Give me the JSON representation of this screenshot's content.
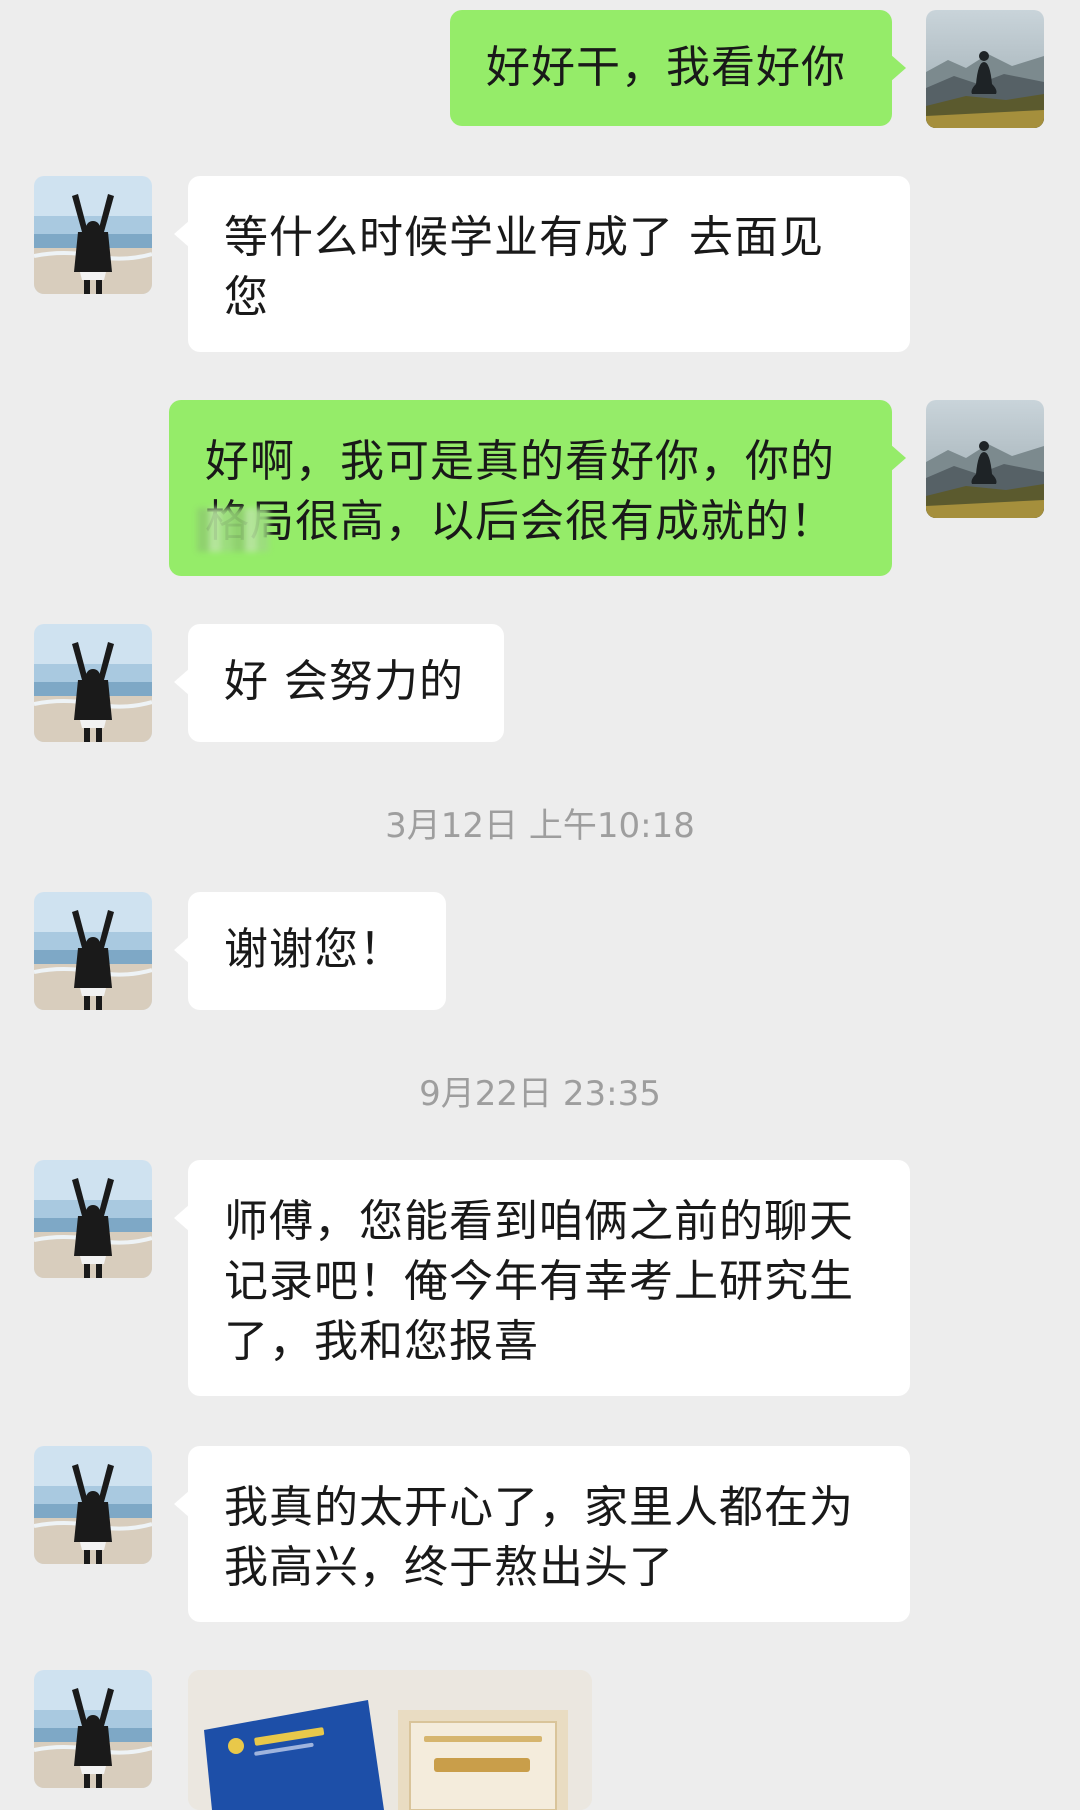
{
  "messages": [
    {
      "side": "sent",
      "text": "好好干，我看好你"
    },
    {
      "side": "recv",
      "text": "等什么时候学业有成了 去面见您"
    },
    {
      "side": "sent",
      "text": "好啊，我可是真的看好你，你的格局很高，以后会很有成就的！"
    },
    {
      "side": "recv",
      "text": "好 会努力的"
    },
    {
      "side": "recv",
      "text": "谢谢您！"
    },
    {
      "side": "recv",
      "text": "师傅，您能看到咱俩之前的聊天记录吧！俺今年有幸考上研究生了，我和您报喜"
    },
    {
      "side": "recv",
      "text": "我真的太开心了，家里人都在为我高兴，终于熬出头了"
    },
    {
      "side": "recv",
      "type": "image"
    }
  ],
  "timestamps": [
    "3月12日 上午10:18",
    "9月22日 23:35"
  ],
  "message_texts": {
    "m1": "好好干，我看好你",
    "m2_line1": "等什么时候学业有成了 去面见",
    "m2_line2": "您",
    "m3_line1": "好啊，我可是真的看好你，你的",
    "m3_line2": "格局很高，以后会很有成就的！",
    "m4": "好 会努力的",
    "m5": "谢谢您！",
    "m6_line1": "师傅，您能看到咱俩之前的聊天",
    "m6_line2": "记录吧！俺今年有幸考上研究生",
    "m6_line3": "了，我和您报喜",
    "m7_line1": "我真的太开心了，家里人都在为",
    "m7_line2": "我高兴，终于熬出头了"
  },
  "colors": {
    "background": "#ededed",
    "sent_bubble": "#95ec69",
    "recv_bubble": "#ffffff",
    "timestamp_text": "#9e9e9e"
  },
  "icons": {
    "self_avatar": "meditating-person-mountain-avatar",
    "contact_avatar": "person-arms-raised-beach-avatar"
  }
}
